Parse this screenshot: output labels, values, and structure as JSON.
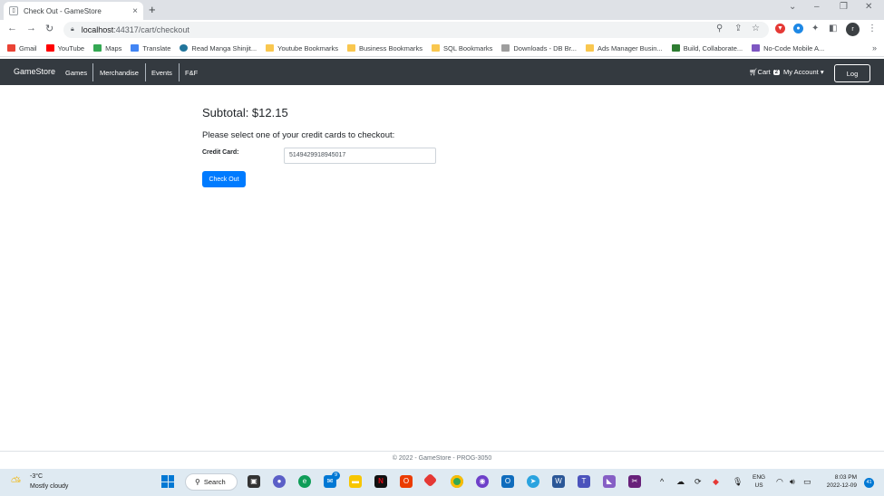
{
  "browser": {
    "tab_title": "Check Out - GameStore",
    "new_tab": "+",
    "url_host": "localhost",
    "url_path": ":44317/cart/checkout",
    "profile_initial": "r",
    "bookmarks": [
      {
        "label": "Gmail",
        "color": "#ea4335"
      },
      {
        "label": "YouTube",
        "color": "#ff0000"
      },
      {
        "label": "Maps",
        "color": "#34a853"
      },
      {
        "label": "Translate",
        "color": "#4285f4"
      },
      {
        "label": "Read Manga Shinjit...",
        "color": "#21759b"
      },
      {
        "label": "Youtube Bookmarks",
        "color": "#f9c74f"
      },
      {
        "label": "Business Bookmarks",
        "color": "#f9c74f"
      },
      {
        "label": "SQL Bookmarks",
        "color": "#f9c74f"
      },
      {
        "label": "Downloads - DB Br...",
        "color": "#9e9e9e"
      },
      {
        "label": "Ads Manager Busin...",
        "color": "#f9c74f"
      },
      {
        "label": "Build, Collaborate...",
        "color": "#2e7d32"
      },
      {
        "label": "No-Code Mobile A...",
        "color": "#7e57c2"
      }
    ],
    "more_bookmarks": "»"
  },
  "navbar": {
    "brand": "GameStore",
    "links": [
      "Games",
      "Merchandise",
      "Events",
      "F&F"
    ],
    "cart_label": "Cart",
    "cart_count": "2",
    "account_label": "My Account",
    "logout_label": "Log Out"
  },
  "checkout": {
    "subtotal": "Subtotal: $12.15",
    "prompt": "Please select one of your credit cards to checkout:",
    "cc_label": "Credit Card:",
    "cc_value": "5149429918945017",
    "button_label": "Check Out"
  },
  "footer": {
    "text": "© 2022 - GameStore - PROG-3050"
  },
  "taskbar": {
    "temperature": "-3°C",
    "condition": "Mostly cloudy",
    "search_label": "Search",
    "mail_badge": "9",
    "lang_top": "ENG",
    "lang_bottom": "US",
    "time": "8:03 PM",
    "date": "2022-12-09",
    "notification_count": "41"
  },
  "colors": {
    "navbar_bg": "#343a40",
    "primary": "#007bff"
  }
}
